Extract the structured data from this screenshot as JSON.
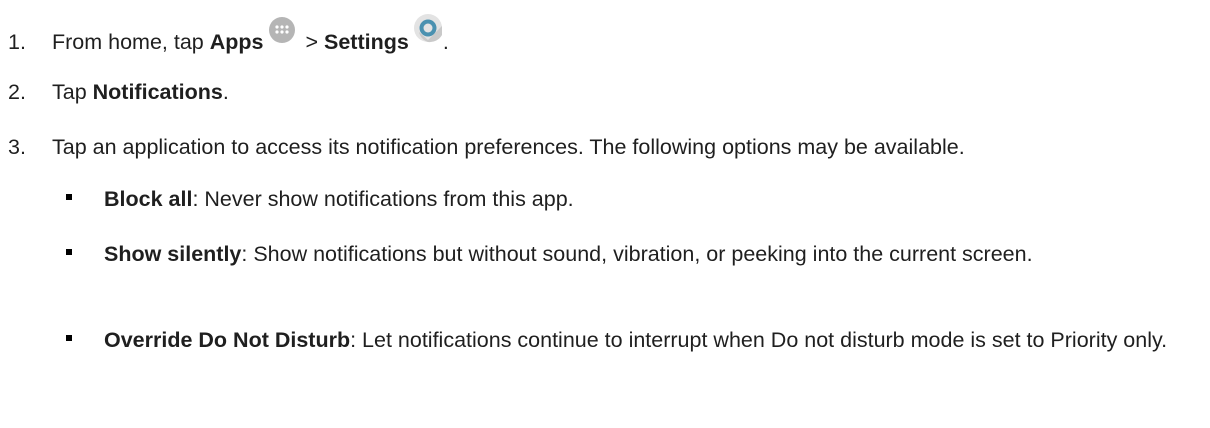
{
  "steps": [
    {
      "number": "1.",
      "text_a": "From home, tap ",
      "bold_a": "Apps",
      "text_b": " > ",
      "bold_b": "Settings",
      "text_c": ".",
      "icons": [
        "apps-icon",
        "settings-icon"
      ]
    },
    {
      "number": "2.",
      "text_a": "Tap ",
      "bold_a": "Notifications",
      "text_b": "."
    },
    {
      "number": "3.",
      "text_a": "Tap an application to access its notification preferences. The following options may be available."
    }
  ],
  "options": [
    {
      "title": "Block all",
      "description": ": Never show notifications from this app."
    },
    {
      "title": "Show silently",
      "description": ": Show notifications but without sound, vibration, or peeking into the current screen."
    },
    {
      "title": "Override Do Not Disturb",
      "description": ": Let notifications continue to interrupt when Do not disturb mode is set to Priority only."
    }
  ]
}
